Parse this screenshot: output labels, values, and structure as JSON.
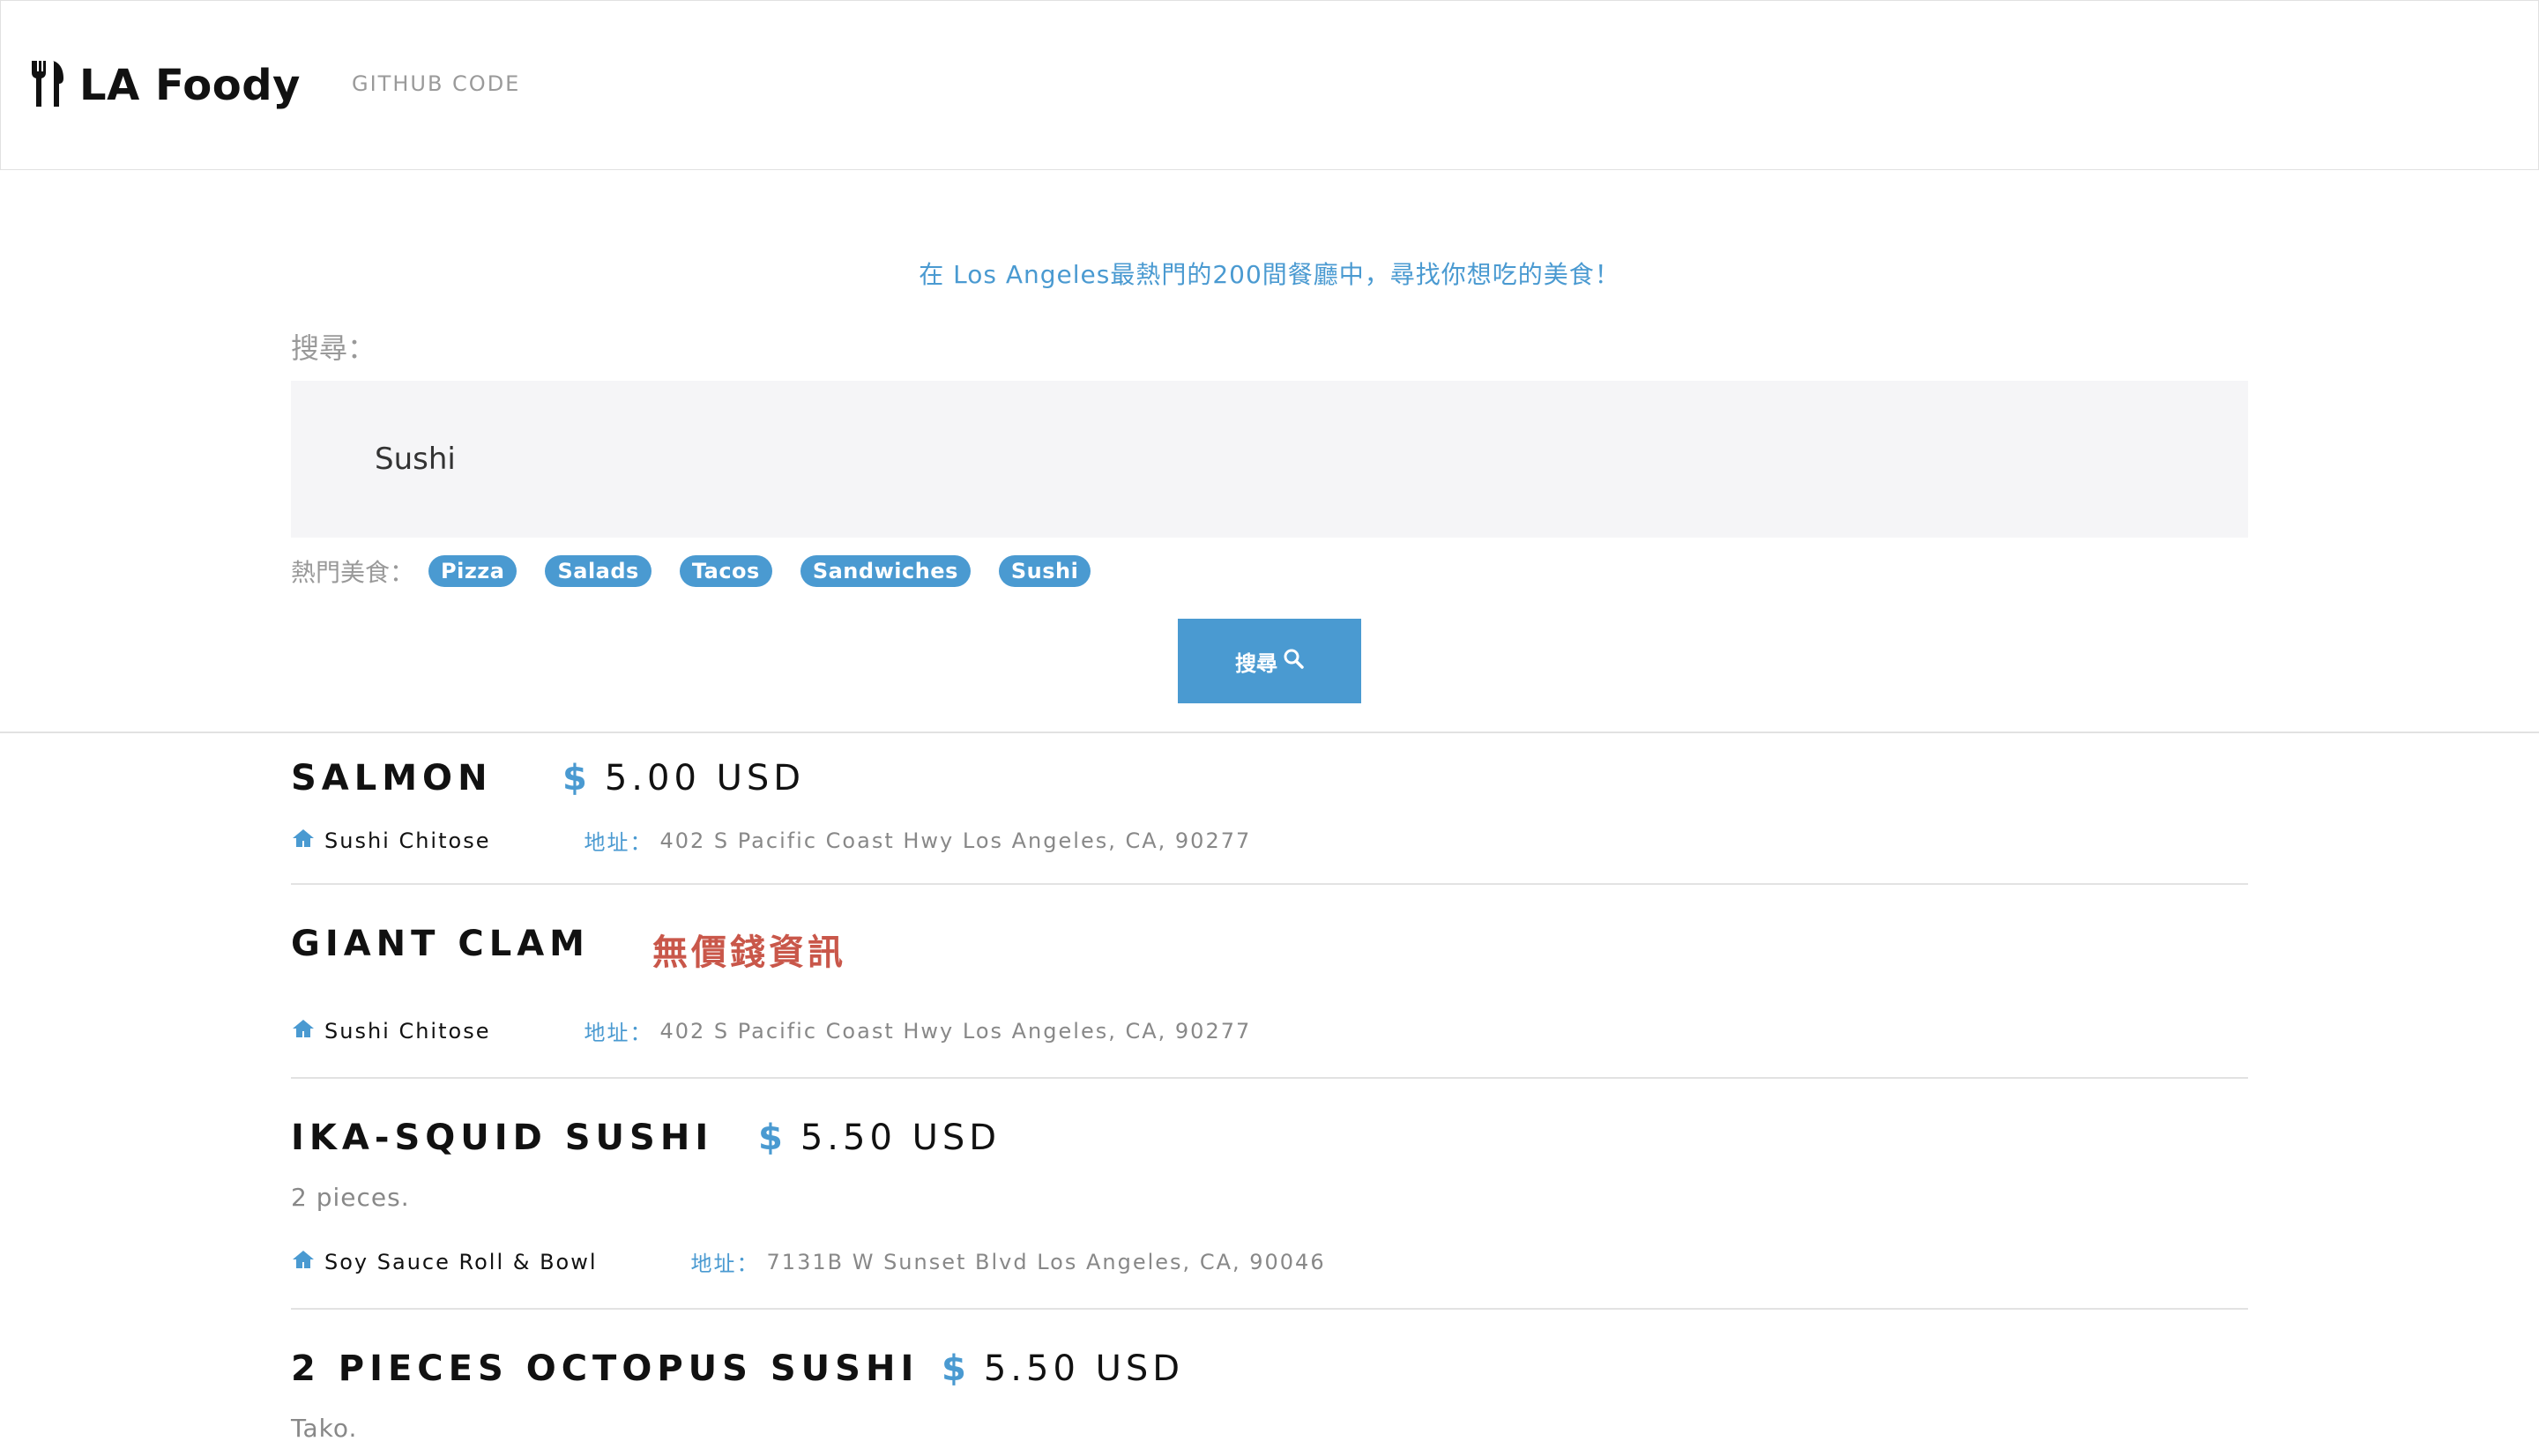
{
  "nav": {
    "brand": "LA Foody",
    "link": "GITHUB CODE"
  },
  "tagline": "在 Los Angeles最熱門的200間餐廳中，尋找你想吃的美食！",
  "search": {
    "label": "搜尋：",
    "value": "Sushi",
    "hot_label": "熱門美食：",
    "tags": [
      "Pizza",
      "Salads",
      "Tacos",
      "Sandwiches",
      "Sushi"
    ],
    "button_label": "搜尋"
  },
  "address_label": "地址：",
  "results": [
    {
      "name": "SALMON",
      "price": "5.00 USD",
      "restaurant": "Sushi Chitose",
      "address": "402 S Pacific Coast Hwy Los Angeles, CA, 90277"
    },
    {
      "name": "GIANT CLAM",
      "no_price": "無價錢資訊",
      "restaurant": "Sushi Chitose",
      "address": "402 S Pacific Coast Hwy Los Angeles, CA, 90277"
    },
    {
      "name": "IKA-SQUID SUSHI",
      "price": "5.50 USD",
      "description": "2 pieces.",
      "restaurant": "Soy Sauce Roll & Bowl",
      "address": "7131B W Sunset Blvd Los Angeles, CA, 90046"
    },
    {
      "name": "2 PIECES OCTOPUS SUSHI",
      "price": "5.50 USD",
      "description": "Tako."
    }
  ],
  "colors": {
    "accent": "#4a9ad1",
    "no_price": "#c9574a"
  }
}
